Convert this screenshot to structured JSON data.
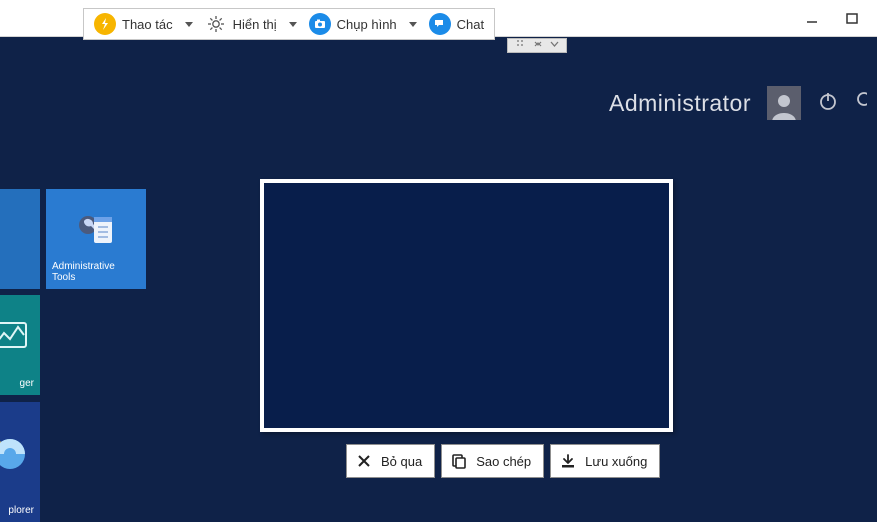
{
  "toolbar": {
    "action": "Thao tác",
    "display": "Hiển thị",
    "capture": "Chụp hình",
    "chat": "Chat"
  },
  "header": {
    "user": "Administrator"
  },
  "tiles": {
    "admin_tools": "Administrative Tools",
    "manager_suffix": "ger",
    "explorer_suffix": "plorer"
  },
  "capture_actions": {
    "skip": "Bỏ qua",
    "copy": "Sao chép",
    "save": "Lưu xuống"
  }
}
